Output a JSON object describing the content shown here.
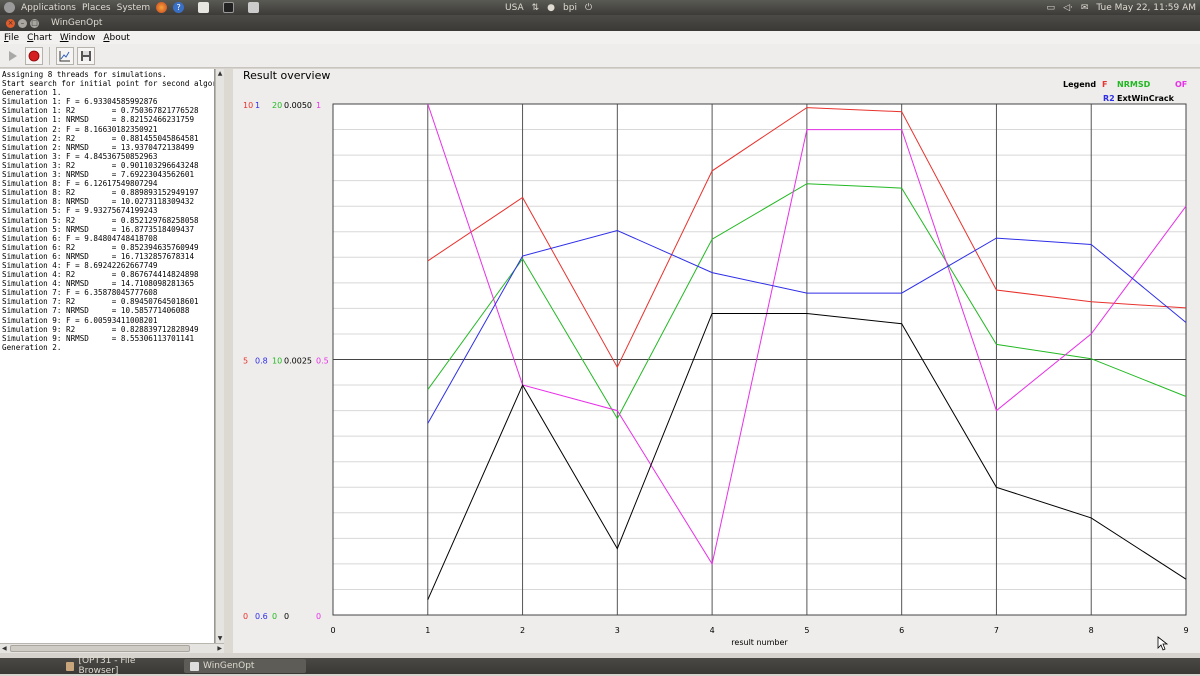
{
  "top_panel": {
    "menus": [
      "Applications",
      "Places",
      "System"
    ],
    "keyboard": "USA",
    "user": "bpi",
    "clock": "Tue May 22, 11:59 AM"
  },
  "window": {
    "title": "WinGenOpt"
  },
  "menubar": {
    "items": [
      {
        "mnemonic": "F",
        "rest": "ile"
      },
      {
        "mnemonic": "C",
        "rest": "hart"
      },
      {
        "mnemonic": "W",
        "rest": "indow"
      },
      {
        "mnemonic": "A",
        "rest": "bout"
      }
    ]
  },
  "toolbar": {
    "buttons": [
      "play-icon",
      "record-stop-icon",
      "chart-icon",
      "save-icon"
    ]
  },
  "log": {
    "lines": [
      "Assigning 8 threads for simulations.",
      "Start search for initial point for second algori",
      "Generation 1.",
      "Simulation 1: F = 6.93304585992876",
      "Simulation 1: R2        = 0.750367821776528",
      "Simulation 1: NRMSD     = 8.82152466231759",
      "Simulation 2: F = 8.16630182350921",
      "Simulation 2: R2        = 0.881455045864581",
      "Simulation 2: NRMSD     = 13.9370472138499",
      "Simulation 3: F = 4.84536750852963",
      "Simulation 3: R2        = 0.901103296643248",
      "Simulation 3: NRMSD     = 7.69223043562601",
      "Simulation 8: F = 6.12617549807294",
      "Simulation 8: R2        = 0.889893152949197",
      "Simulation 8: NRMSD     = 10.0273118309432",
      "Simulation 5: F = 9.93275674199243",
      "Simulation 5: R2        = 0.852129768258058",
      "Simulation 5: NRMSD     = 16.8773518409437",
      "Simulation 6: F = 9.84804748418708",
      "Simulation 6: R2        = 0.852394635760949",
      "Simulation 6: NRMSD     = 16.7132857678314",
      "Simulation 4: F = 8.69242262667749",
      "Simulation 4: R2        = 0.867674414824898",
      "Simulation 4: NRMSD     = 14.7108098281365",
      "Simulation 7: F = 6.35878045777608",
      "Simulation 7: R2        = 0.894507645018601",
      "Simulation 7: NRMSD     = 10.585771406088",
      "Simulation 9: F = 6.00593411008201",
      "Simulation 9: R2        = 0.828839712828949",
      "Simulation 9: NRMSD     = 8.55306113701141",
      "Generation 2."
    ]
  },
  "chart_data": {
    "type": "line",
    "title": "Result overview",
    "xlabel": "result number",
    "x": [
      0,
      1,
      2,
      3,
      4,
      5,
      6,
      7,
      8,
      9
    ],
    "xlim": [
      0,
      9
    ],
    "legend_title": "Legend",
    "legend_position": "top-right",
    "axes": [
      {
        "series": "F",
        "color": "#e8322d",
        "top": "10",
        "mid": "5",
        "bottom": "0"
      },
      {
        "series": "R2",
        "color": "#2e2ee8",
        "top": "1",
        "mid": "0.8",
        "bottom": "0.6"
      },
      {
        "series": "NRMSD",
        "color": "#22b822",
        "top": "20",
        "mid": "10",
        "bottom": "0"
      },
      {
        "series": "ExtWinCrack",
        "color": "#000000",
        "top": "0.0050",
        "mid": "0.0025",
        "bottom": "0"
      },
      {
        "series": "OF",
        "color": "#e830e8",
        "top": "1",
        "mid": "0.5",
        "bottom": "0"
      }
    ],
    "series": [
      {
        "name": "F",
        "color": "#e8322d",
        "ylim": [
          0,
          10
        ],
        "x": [
          1,
          2,
          3,
          4,
          5,
          6,
          7,
          8,
          9
        ],
        "values": [
          6.93,
          8.17,
          4.85,
          8.69,
          9.93,
          9.85,
          6.36,
          6.13,
          6.01
        ]
      },
      {
        "name": "NRMSD",
        "color": "#22b822",
        "ylim": [
          0,
          20
        ],
        "x": [
          1,
          2,
          3,
          4,
          5,
          6,
          7,
          8,
          9
        ],
        "values": [
          8.82,
          13.94,
          7.69,
          14.71,
          16.88,
          16.71,
          10.59,
          10.03,
          8.55
        ]
      },
      {
        "name": "OF",
        "color": "#e830e8",
        "ylim": [
          0,
          1
        ],
        "x": [
          1,
          2,
          3,
          4,
          5,
          6,
          7,
          8,
          9
        ],
        "values": [
          1.0,
          0.45,
          0.4,
          0.1,
          0.95,
          0.95,
          0.4,
          0.55,
          0.8
        ]
      },
      {
        "name": "R2",
        "color": "#2e2ee8",
        "ylim": [
          0.6,
          1.0
        ],
        "x": [
          1,
          2,
          3,
          4,
          5,
          6,
          7,
          8,
          9
        ],
        "values": [
          0.75,
          0.881,
          0.901,
          0.868,
          0.852,
          0.852,
          0.895,
          0.89,
          0.829
        ]
      },
      {
        "name": "ExtWinCrack",
        "color": "#000000",
        "ylim": [
          0,
          0.005
        ],
        "x": [
          1,
          2,
          3,
          4,
          5,
          6,
          7,
          8,
          9
        ],
        "values": [
          0.00015,
          0.00225,
          0.00065,
          0.00295,
          0.00295,
          0.00285,
          0.00125,
          0.00095,
          0.00035
        ]
      }
    ],
    "grid": true
  },
  "taskbar": {
    "tasks": [
      "[OPT31 - File Browser]",
      "WinGenOpt"
    ]
  }
}
